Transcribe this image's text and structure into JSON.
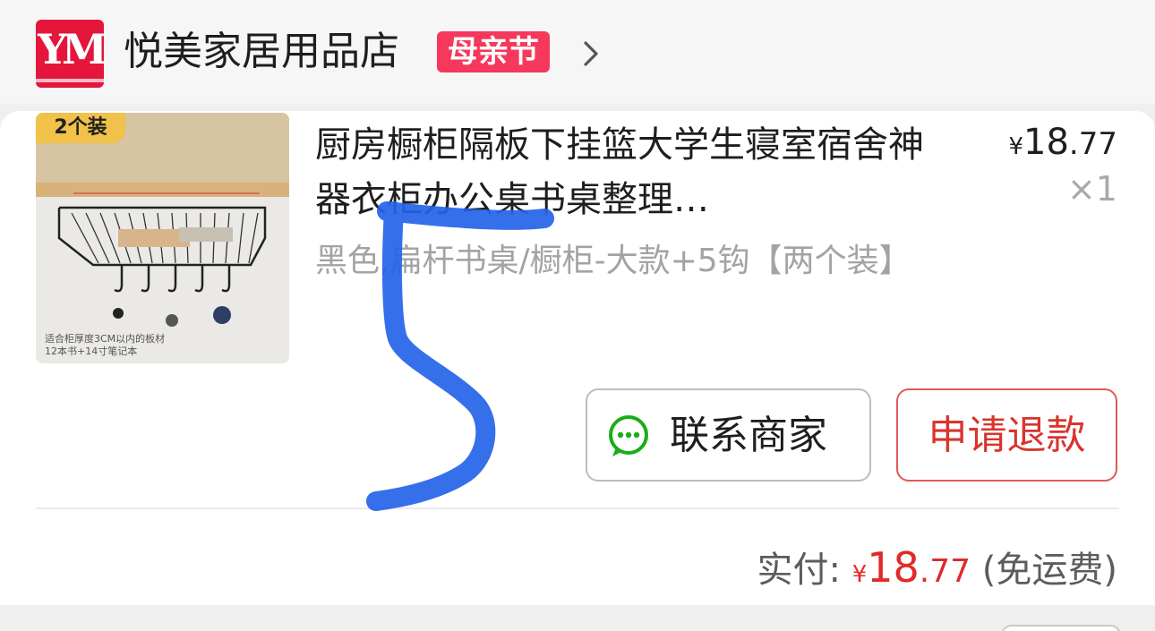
{
  "shop": {
    "name": "悦美家居用品店",
    "promo_badge": "母亲节",
    "logo_text": "YM"
  },
  "order": {
    "image_badge": "2个装",
    "image_caption_line1": "适合柜厚度3CM以内的板材",
    "image_caption_line2": "12本书+14寸笔记本",
    "title": "厨房橱柜隔板下挂篮大学生寝室宿舍神器衣柜办公桌书桌整理…",
    "spec": "黑色,扁杆书桌/橱柜-大款+5钩【两个装】",
    "price_symbol": "¥",
    "price_int": "18",
    "price_dec": ".77",
    "quantity": "×1",
    "contact_button": "联系商家",
    "refund_button": "申请退款",
    "paid_label": "实付:",
    "paid_symbol": "¥",
    "paid_int": "18",
    "paid_dec": ".77",
    "shipping_note": "(免运费)"
  },
  "colors": {
    "accent_red": "#e02a2a",
    "promo_pink": "#f5385b",
    "logo_red": "#e4163c",
    "wechat_green": "#1aad19",
    "scribble_blue": "#2563e8"
  },
  "icons": [
    "chevron-right-icon",
    "wechat-icon"
  ]
}
